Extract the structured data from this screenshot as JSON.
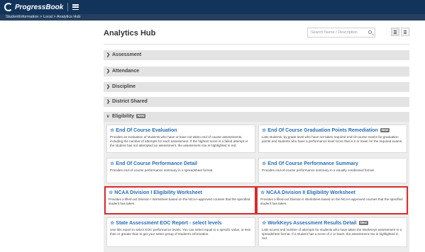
{
  "app": {
    "logo_text": "ProgressBook"
  },
  "breadcrumb": "StudentInformation > Local > Analytics Hub",
  "page": {
    "title": "Analytics Hub"
  },
  "search": {
    "placeholder": "Search Name / Description"
  },
  "sections": [
    {
      "label": "Assessment",
      "expanded": false
    },
    {
      "label": "Attendance",
      "expanded": false
    },
    {
      "label": "Discipline",
      "expanded": false
    },
    {
      "label": "District Shared",
      "expanded": false
    },
    {
      "label": "Eligibility",
      "expanded": true,
      "badge": "New"
    }
  ],
  "cards": [
    {
      "title": "End Of Course Evaluation",
      "badge": "",
      "desc": "Provides an evaluation of students who have or have not taken end of course assessments, including the number of attempts for each assessment. If the highest score is a failed attempt or the student has not attempted an assessment, the assessment row is highlighted in red.",
      "highlighted": false
    },
    {
      "title": "End Of Course Graduation Points Remediation",
      "badge": "New",
      "desc": "Lists students, by grade level who have not taken required end-of-course exams for graduation points and students who have a performance level score that is 2 or lower for the required exams.",
      "highlighted": false
    },
    {
      "title": "End Of Course Performance Detail",
      "badge": "",
      "desc": "Provides end-of-course performance summary in a spreadsheet format.",
      "highlighted": false
    },
    {
      "title": "End Of Course Performance Summary",
      "badge": "",
      "desc": "Provides end-of-course performance summary in a visually condensed format.",
      "highlighted": false
    },
    {
      "title": "NCAA Division I Eligibility Worksheet",
      "badge": "",
      "desc": "Provides a filled-out Division I Worksheet based on the NCAA-approved courses that the specified student has taken.",
      "highlighted": true
    },
    {
      "title": "NCAA Division II Eligibility Worksheet",
      "badge": "",
      "desc": "Provides a filled-out Division II Worksheet based on the NCAA-approved courses that the specified student has taken.",
      "highlighted": true
    },
    {
      "title": "State Assessment EOC Report - select levels",
      "badge": "",
      "desc": "Use this report to select EOC performance levels. You can select equal to a specific value, or less than or greater than to get your select group of student's information.",
      "highlighted": false
    },
    {
      "title": "WorkKeys Assessment Results Detail",
      "badge": "New",
      "desc": "Lists scores and number of attempts for students who have taken the WorkKeys assessment in a spreadsheet format. If a student has a score of 2 or lower, the assessment row is highlighted in red.",
      "highlighted": false
    }
  ],
  "colors": {
    "topbar": "#12345a",
    "link": "#2a6db2",
    "highlight_border": "#d82b2b"
  }
}
